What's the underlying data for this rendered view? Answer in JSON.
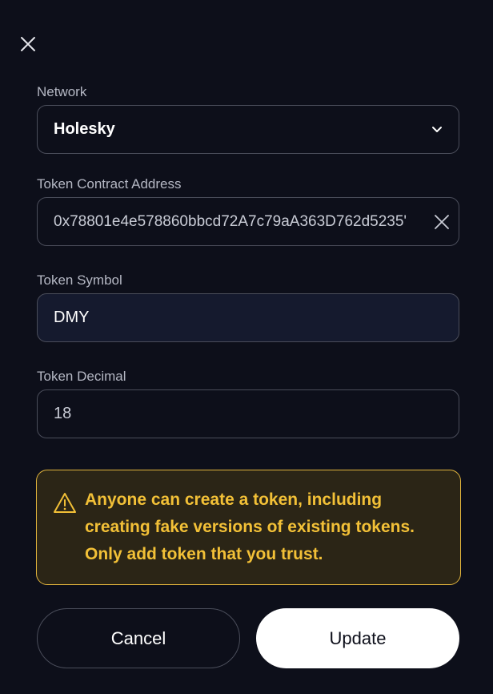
{
  "dialog": {
    "close_icon": "close-icon"
  },
  "form": {
    "network": {
      "label": "Network",
      "value": "Holesky",
      "icon": "chevron-down-icon"
    },
    "contract_address": {
      "label": "Token Contract Address",
      "value": "0x78801e4e578860bbcd72A7c79aA363D762d5235'",
      "icon": "clear-icon"
    },
    "symbol": {
      "label": "Token Symbol",
      "value": "DMY"
    },
    "decimal": {
      "label": "Token Decimal",
      "value": "18"
    }
  },
  "warning": {
    "icon": "warning-icon",
    "text_line1": "Anyone can create a token, including",
    "text_line2": "creating fake versions of existing tokens.",
    "text_line3": "Only add token that you trust.",
    "color": "#f2c037"
  },
  "actions": {
    "cancel_label": "Cancel",
    "update_label": "Update"
  }
}
